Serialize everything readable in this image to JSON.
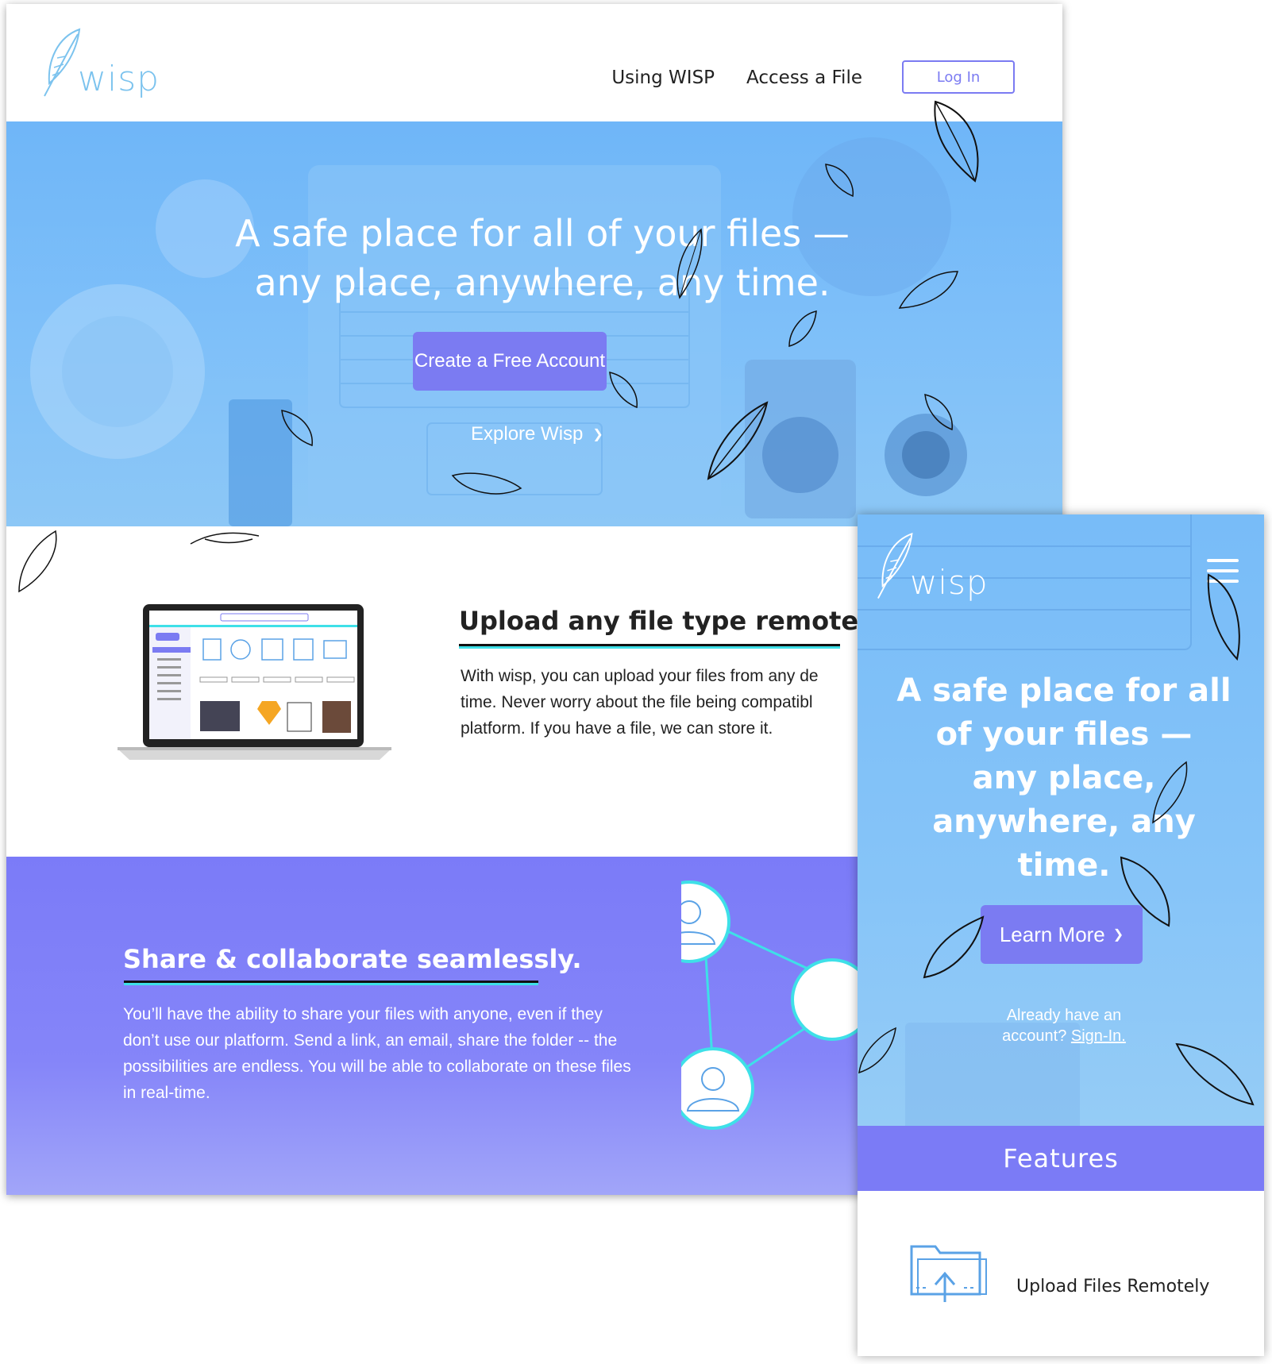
{
  "desktop": {
    "logo": "wisp",
    "nav": {
      "using": "Using WISP",
      "access": "Access a File",
      "login": "Log In"
    },
    "hero": {
      "title_line1": "A safe place for all of your files —",
      "title_line2": "any place, anywhere, any time.",
      "cta": "Create a Free Account",
      "explore": "Explore Wisp"
    },
    "upload": {
      "title": "Upload any file type remotely.",
      "text": "With wisp, you can upload your files from any de\ntime. Never worry about the file being compatibl\nplatform. If you have a file, we can store it."
    },
    "share": {
      "title": "Share & collaborate seamlessly.",
      "text": "You’ll have the ability to share your files with anyone, even if they don’t use our platform. Send a link, an email, share the folder -- the possibilities are endless. You will be able to collaborate on these files in real-time."
    }
  },
  "mobile": {
    "logo": "wisp",
    "hero": {
      "title_line1": "A safe place for all",
      "title_line2": "of your files —",
      "title_line3": "any place,",
      "title_line4": "anywhere, any time.",
      "learn_more": "Learn More",
      "already": "Already have an",
      "account": "account?",
      "signin": "Sign-In."
    },
    "features_title": "Features",
    "feature_1": "Upload Files Remotely"
  },
  "colors": {
    "brand_purple": "#7b7bf2",
    "hero_blue": "#7fc0f9",
    "accent_cyan": "#3ee0e8",
    "logo_blue": "#7cc3ee"
  },
  "icons": [
    "feather-logo-icon",
    "chevron-down-icon",
    "hamburger-menu-icon",
    "user-icon",
    "upload-folder-icon",
    "leaf-icon"
  ]
}
